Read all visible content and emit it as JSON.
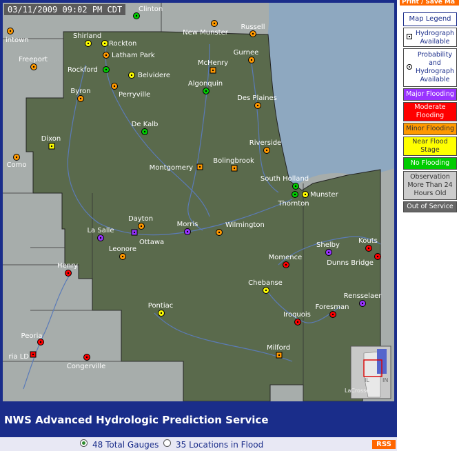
{
  "timestamp": "03/11/2009 09:02 PM CDT",
  "print_button": "Print / Save Ma",
  "footer_title": "NWS Advanced Hydrologic Prediction Service",
  "bottom": {
    "total_label": "48 Total Gauges",
    "flood_label": "35 Locations in Flood",
    "rss_label": "RSS"
  },
  "legend": {
    "title": "Map Legend",
    "hydrograph": "Hydrograph Available",
    "probability": "Probability and Hydrograph Available",
    "major": "Major Flooding",
    "moderate": "Moderate Flooding",
    "minor": "Minor Flooding",
    "near": "Near Flood Stage",
    "none": "No Flooding",
    "obs_old": "Observation More Than 24 Hours Old",
    "out_of_service": "Out of Service"
  },
  "colors": {
    "major": "#9933ff",
    "moderate": "#ff0000",
    "minor": "#ff9900",
    "near": "#ffff00",
    "none": "#00cc00",
    "frame": "#1a2d8a",
    "lake": "#8ea8c0",
    "hsa": "#5a6a4c",
    "outside": "#a7adab"
  },
  "inset": {
    "label": "LaCrosse",
    "state_abbr": "IL",
    "state_abbr2": "IN"
  },
  "gauges": [
    {
      "name": "Clinton",
      "status": "none",
      "shape": "circle"
    },
    {
      "name": "intown",
      "status": "minor",
      "shape": "circle"
    },
    {
      "name": "Shirland",
      "status": "near",
      "shape": "circle"
    },
    {
      "name": "Rockton",
      "status": "near",
      "shape": "circle"
    },
    {
      "name": "Latham Park",
      "status": "minor",
      "shape": "circle"
    },
    {
      "name": "New Munster",
      "status": "minor",
      "shape": "circle"
    },
    {
      "name": "Russell",
      "status": "minor",
      "shape": "circle"
    },
    {
      "name": "Freeport",
      "status": "minor",
      "shape": "circle"
    },
    {
      "name": "Rockford",
      "status": "none",
      "shape": "circle"
    },
    {
      "name": "Belvidere",
      "status": "near",
      "shape": "circle"
    },
    {
      "name": "McHenry",
      "status": "minor",
      "shape": "square"
    },
    {
      "name": "Gurnee",
      "status": "minor",
      "shape": "circle"
    },
    {
      "name": "Byron",
      "status": "minor",
      "shape": "circle"
    },
    {
      "name": "Perryville",
      "status": "minor",
      "shape": "circle"
    },
    {
      "name": "Algonquin",
      "status": "none",
      "shape": "circle"
    },
    {
      "name": "Des Plaines",
      "status": "minor",
      "shape": "circle"
    },
    {
      "name": "De Kalb",
      "status": "none",
      "shape": "circle"
    },
    {
      "name": "Dixon",
      "status": "near",
      "shape": "square"
    },
    {
      "name": "Riverside",
      "status": "minor",
      "shape": "circle"
    },
    {
      "name": "Como",
      "status": "minor",
      "shape": "circle"
    },
    {
      "name": "Montgomery",
      "status": "minor",
      "shape": "square"
    },
    {
      "name": "Bolingbrook",
      "status": "minor",
      "shape": "square"
    },
    {
      "name": "South Holland",
      "status": "none",
      "shape": "circle"
    },
    {
      "name": "Thornton",
      "status": "none",
      "shape": "circle"
    },
    {
      "name": "Munster",
      "status": "near",
      "shape": "circle"
    },
    {
      "name": "Dayton",
      "status": "minor",
      "shape": "circle"
    },
    {
      "name": "La Salle",
      "status": "major",
      "shape": "circle"
    },
    {
      "name": "Ottawa",
      "status": "major",
      "shape": "square"
    },
    {
      "name": "Morris",
      "status": "major",
      "shape": "circle"
    },
    {
      "name": "Wilmington",
      "status": "minor",
      "shape": "circle"
    },
    {
      "name": "Leonore",
      "status": "minor",
      "shape": "circle"
    },
    {
      "name": "Shelby",
      "status": "major",
      "shape": "circle"
    },
    {
      "name": "Kouts",
      "status": "moderate",
      "shape": "circle"
    },
    {
      "name": "Henry",
      "status": "moderate",
      "shape": "circle"
    },
    {
      "name": "Momence",
      "status": "moderate",
      "shape": "circle"
    },
    {
      "name": "Dunns Bridge",
      "status": "moderate",
      "shape": "circle"
    },
    {
      "name": "Chebanse",
      "status": "near",
      "shape": "circle"
    },
    {
      "name": "Rensselaer",
      "status": "major",
      "shape": "circle"
    },
    {
      "name": "Foresman",
      "status": "moderate",
      "shape": "circle"
    },
    {
      "name": "Pontiac",
      "status": "near",
      "shape": "circle"
    },
    {
      "name": "Iroquois",
      "status": "moderate",
      "shape": "circle"
    },
    {
      "name": "Peoria",
      "status": "moderate",
      "shape": "circle"
    },
    {
      "name": "ria LD",
      "status": "moderate",
      "shape": "square"
    },
    {
      "name": "Congerville",
      "status": "moderate",
      "shape": "circle"
    },
    {
      "name": "Milford",
      "status": "minor",
      "shape": "square"
    }
  ]
}
